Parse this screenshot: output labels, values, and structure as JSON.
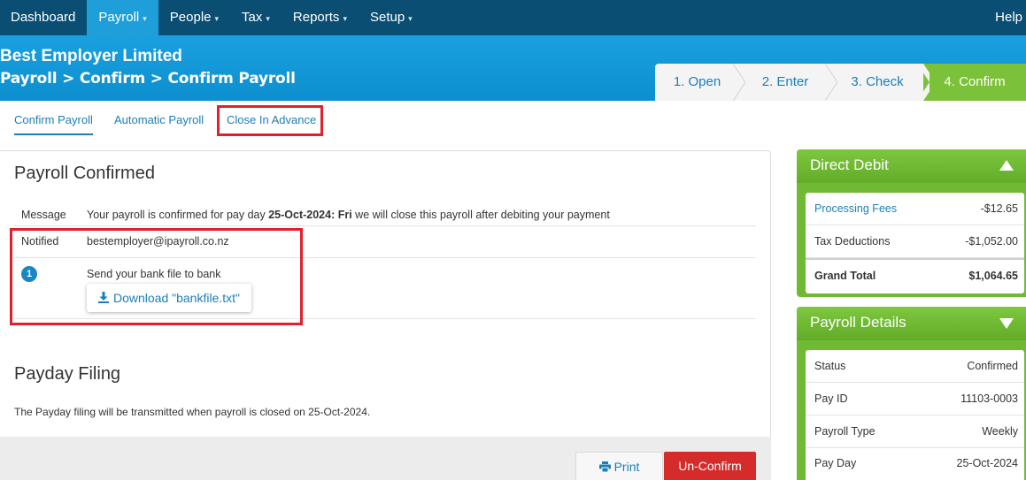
{
  "nav": {
    "items": [
      {
        "label": "Dashboard",
        "caret": ""
      },
      {
        "label": "Payroll",
        "caret": "▾"
      },
      {
        "label": "People",
        "caret": "▾"
      },
      {
        "label": "Tax",
        "caret": "▾"
      },
      {
        "label": "Reports",
        "caret": "▾"
      },
      {
        "label": "Setup",
        "caret": "▾"
      }
    ],
    "active": "Payroll",
    "help": "Help"
  },
  "header": {
    "company": "Best Employer Limited",
    "breadcrumb": "Payroll > Confirm > Confirm Payroll"
  },
  "steps": [
    {
      "label": "1. Open"
    },
    {
      "label": "2. Enter"
    },
    {
      "label": "3. Check"
    },
    {
      "label": "4. Confirm"
    }
  ],
  "subtabs": [
    {
      "label": "Confirm Payroll"
    },
    {
      "label": "Automatic Payroll"
    },
    {
      "label": "Close In Advance"
    }
  ],
  "main": {
    "title": "Payroll Confirmed",
    "message_label": "Message",
    "message_prefix": "Your payroll is confirmed for pay day ",
    "message_date": "25-Oct-2024: Fri",
    "message_suffix": " we will close this payroll after debiting your payment",
    "notified_label": "Notified",
    "notified_value": "bestemployer@ipayroll.co.nz",
    "step_number": "1",
    "step_text": "Send your bank file to bank",
    "download_label": "Download \"bankfile.txt\"",
    "filing_title": "Payday Filing",
    "filing_text": "The Payday filing will be transmitted when payroll is closed on 25-Oct-2024."
  },
  "buttons": {
    "print": "Print",
    "unconfirm": "Un-Confirm"
  },
  "direct_debit": {
    "title": "Direct Debit",
    "rows": [
      {
        "label": "Processing Fees",
        "value": "-$12.65"
      },
      {
        "label": "Tax Deductions",
        "value": "-$1,052.00"
      },
      {
        "label": "Grand Total",
        "value": "$1,064.65"
      }
    ]
  },
  "payroll_details": {
    "title": "Payroll Details",
    "rows": [
      {
        "label": "Status",
        "value": "Confirmed"
      },
      {
        "label": "Pay ID",
        "value": "11103-0003"
      },
      {
        "label": "Payroll Type",
        "value": "Weekly"
      },
      {
        "label": "Pay Day",
        "value": "25-Oct-2024"
      }
    ]
  },
  "colors": {
    "nav": "#0a4f73",
    "header": "#1aa0df",
    "accent_green": "#6fba32",
    "link": "#1a7fb8",
    "danger": "#d52b2b",
    "highlight": "#e0202a"
  }
}
